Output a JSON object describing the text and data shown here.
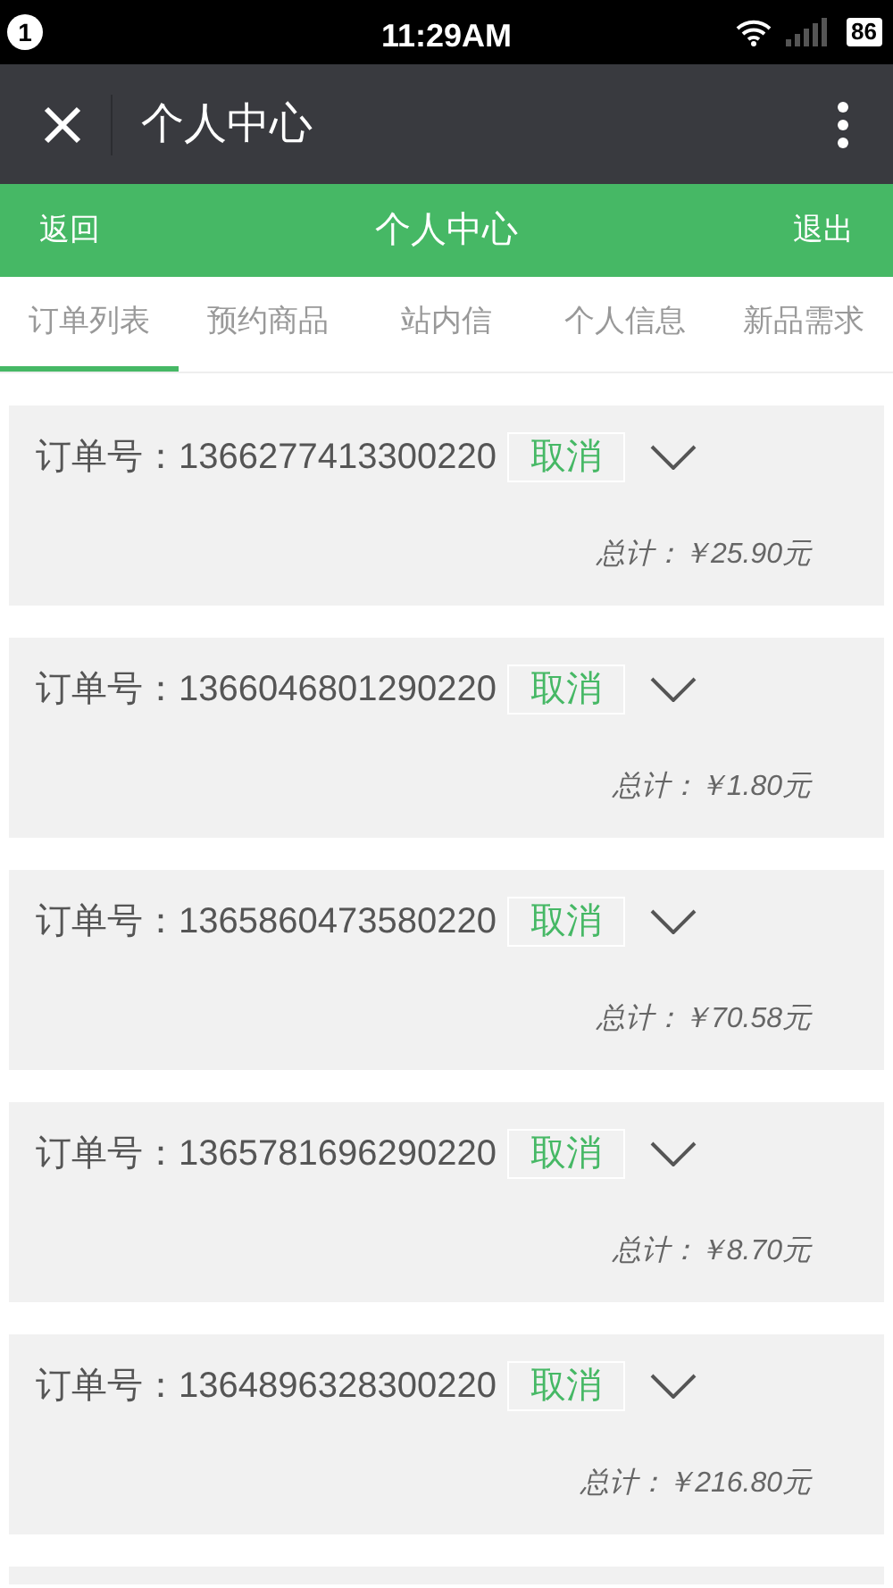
{
  "status_bar": {
    "notification_count": "1",
    "time": "11:29AM",
    "battery": "86"
  },
  "title_bar": {
    "title": "个人中心"
  },
  "header": {
    "back": "返回",
    "title": "个人中心",
    "logout": "退出"
  },
  "tabs": [
    {
      "label": "订单列表",
      "selected": true
    },
    {
      "label": "预约商品",
      "selected": false
    },
    {
      "label": "站内信",
      "selected": false
    },
    {
      "label": "个人信息",
      "selected": false
    },
    {
      "label": "新品需求",
      "selected": false
    }
  ],
  "orders": [
    {
      "order_no": "订单号：1366277413300220",
      "action": "取消",
      "expanded": false,
      "total": "总计：￥25.90元"
    },
    {
      "order_no": "订单号：1366046801290220",
      "action": "取消",
      "expanded": false,
      "total": "总计：￥1.80元"
    },
    {
      "order_no": "订单号：1365860473580220",
      "action": "取消",
      "expanded": false,
      "total": "总计：￥70.58元"
    },
    {
      "order_no": "订单号：1365781696290220",
      "action": "取消",
      "expanded": false,
      "total": "总计：￥8.70元"
    },
    {
      "order_no": "订单号：1364896328300220",
      "action": "取消",
      "expanded": false,
      "total": "总计：￥216.80元"
    }
  ]
}
